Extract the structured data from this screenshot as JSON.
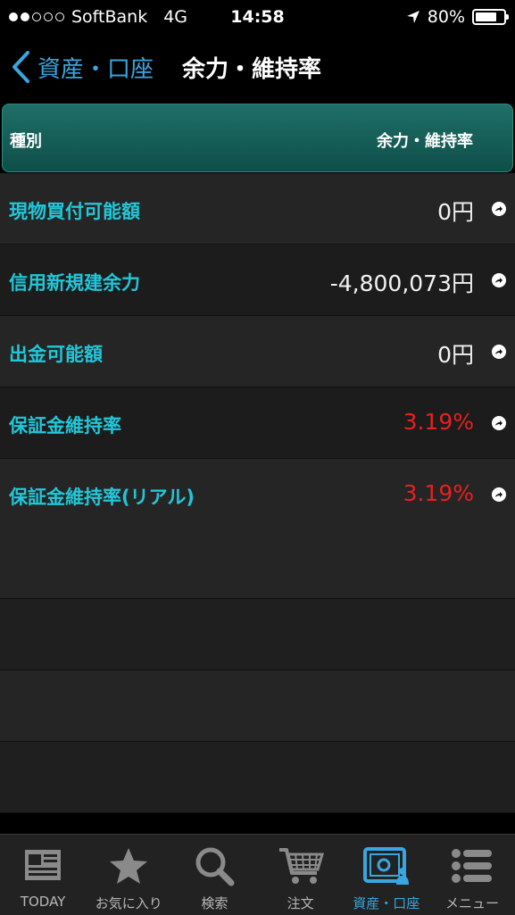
{
  "status_bar": {
    "carrier": "SoftBank",
    "network": "4G",
    "time": "14:58",
    "battery": "80%",
    "battery_level": 0.8
  },
  "nav": {
    "back_label": "資産・口座",
    "title": "余力・維持率"
  },
  "table": {
    "header_left": "種別",
    "header_right": "余力・維持率",
    "rows": [
      {
        "label": "現物買付可能額",
        "value": "0円"
      },
      {
        "label": "信用新規建余力",
        "value": "-4,800,073円"
      },
      {
        "label": "出金可能額",
        "value": "0円"
      },
      {
        "label": "保証金維持率",
        "value": "3.19%"
      },
      {
        "label": "保証金維持率(リアル)",
        "value": "3.19%"
      }
    ]
  },
  "tabs": [
    {
      "label": "TODAY",
      "icon": "newspaper-icon"
    },
    {
      "label": "お気に入り",
      "icon": "star-icon"
    },
    {
      "label": "検索",
      "icon": "search-icon"
    },
    {
      "label": "注文",
      "icon": "cart-icon"
    },
    {
      "label": "資産・口座",
      "icon": "safe-icon"
    },
    {
      "label": "メニュー",
      "icon": "menu-icon"
    }
  ],
  "colors": {
    "accent": "#3aa6e0",
    "label_cyan": "#21c7d9",
    "negative_red": "#e8201f",
    "header_teal": "#1f6f68"
  }
}
